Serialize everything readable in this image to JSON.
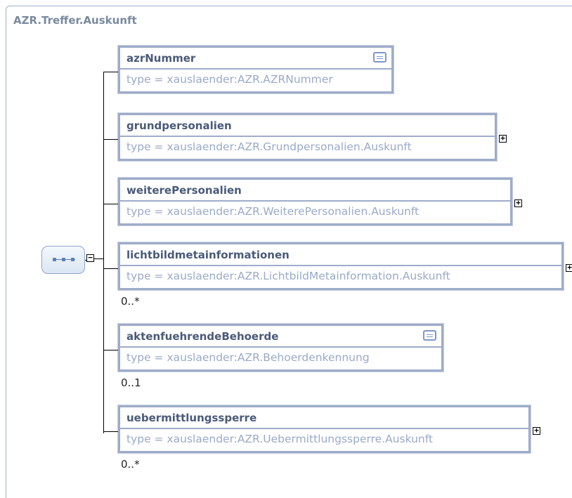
{
  "title": "AZR.Treffer.Auskunft",
  "elements": [
    {
      "name": "azrNummer",
      "type": "type = xauslaender:AZR.AZRNummer",
      "card": "",
      "doc_icon": true,
      "expandable": false
    },
    {
      "name": "grundpersonalien",
      "type": "type = xauslaender:AZR.Grundpersonalien.Auskunft",
      "card": "",
      "doc_icon": false,
      "expandable": true
    },
    {
      "name": "weiterePersonalien",
      "type": "type = xauslaender:AZR.WeiterePersonalien.Auskunft",
      "card": "",
      "doc_icon": false,
      "expandable": true
    },
    {
      "name": "lichtbildmetainformationen",
      "type": "type = xauslaender:AZR.LichtbildMetainformation.Auskunft",
      "card": "0..*",
      "doc_icon": false,
      "expandable": true
    },
    {
      "name": "aktenfuehrendeBehoerde",
      "type": "type = xauslaender:AZR.Behoerdenkennung",
      "card": "0..1",
      "doc_icon": true,
      "expandable": false
    },
    {
      "name": "uebermittlungssperre",
      "type": "type = xauslaender:AZR.Uebermittlungssperre.Auskunft",
      "card": "0..*",
      "doc_icon": false,
      "expandable": true
    }
  ],
  "symbols": {
    "expand": "+",
    "collapse": "−"
  },
  "colors": {
    "border": "#9eacc9",
    "name": "#4a5a78",
    "type": "#9aaac8",
    "title": "#7a8a9e"
  }
}
